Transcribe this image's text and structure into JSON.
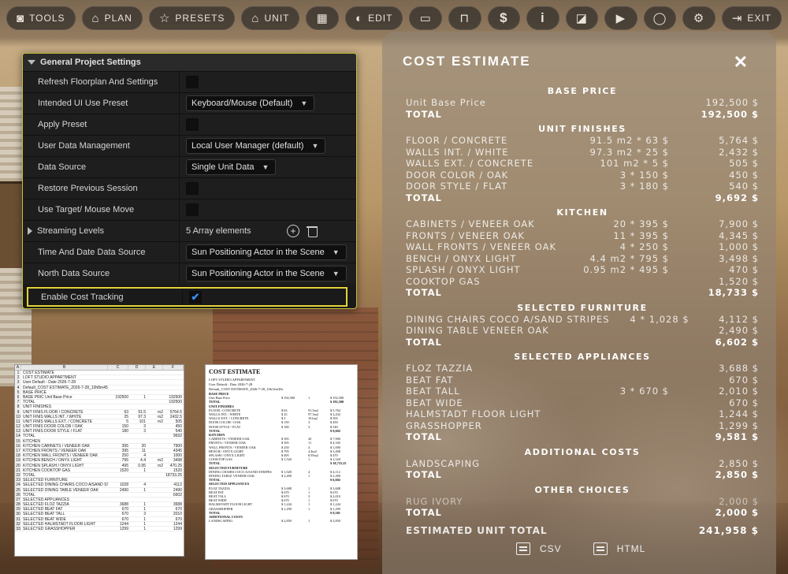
{
  "toolbar": {
    "buttons": [
      {
        "label": "TOOLS",
        "icon": "camera-icon"
      },
      {
        "label": "PLAN",
        "icon": "plan-icon"
      },
      {
        "label": "PRESETS",
        "icon": "star-icon"
      },
      {
        "label": "UNIT",
        "icon": "unit-icon"
      },
      {
        "label": "",
        "icon": "floorplan-icon"
      },
      {
        "label": "EDIT",
        "icon": "palette-icon"
      },
      {
        "label": "",
        "icon": "sofa-icon"
      },
      {
        "label": "",
        "icon": "measure-icon"
      },
      {
        "label": "$",
        "icon": "dollar-icon"
      },
      {
        "label": "i",
        "icon": "info-icon"
      },
      {
        "label": "",
        "icon": "chart-icon"
      },
      {
        "label": "",
        "icon": "play-icon"
      },
      {
        "label": "",
        "icon": "user-icon"
      },
      {
        "label": "",
        "icon": "gear-icon"
      },
      {
        "label": "EXIT",
        "icon": "exit-icon"
      }
    ]
  },
  "settings": {
    "header": "General Project Settings",
    "rows": [
      {
        "label": "Refresh Floorplan And Settings",
        "type": "checkbox",
        "checked": false
      },
      {
        "label": "Intended UI Use Preset",
        "type": "combo",
        "value": "Keyboard/Mouse (Default)"
      },
      {
        "label": "Apply Preset",
        "type": "checkbox",
        "checked": false
      },
      {
        "label": "User Data Management",
        "type": "combo",
        "value": "Local User Manager (default)"
      },
      {
        "label": "Data Source",
        "type": "combo",
        "value": "Single Unit Data"
      },
      {
        "label": "Restore Previous Session",
        "type": "checkbox",
        "checked": false
      },
      {
        "label": "Use Target/ Mouse Move",
        "type": "checkbox",
        "checked": false
      },
      {
        "label": "Streaming Levels",
        "type": "array",
        "value": "5 Array elements"
      },
      {
        "label": "Time And Date Data Source",
        "type": "combo",
        "value": "Sun Positioning Actor in the Scene"
      },
      {
        "label": "North Data Source",
        "type": "combo",
        "value": "Sun Positioning Actor in the Scene"
      },
      {
        "label": "Enable Cost Tracking",
        "type": "checkbox",
        "checked": true
      }
    ]
  },
  "cost": {
    "title": "COST ESTIMATE",
    "close": "✕",
    "sections": [
      {
        "heading": "BASE PRICE",
        "lines": [
          {
            "name": "Unit Base Price",
            "qty": "",
            "amount": "192,500 $"
          }
        ],
        "total": "192,500 $"
      },
      {
        "heading": "UNIT FINISHES",
        "lines": [
          {
            "name": "FLOOR / CONCRETE",
            "qty": "91.5 m2 * 63 $",
            "amount": "5,764 $"
          },
          {
            "name": "WALLS INT. / WHITE",
            "qty": "97.3 m2 * 25 $",
            "amount": "2,432 $"
          },
          {
            "name": "WALLS EXT. / CONCRETE",
            "qty": "101 m2 * 5 $",
            "amount": "505 $"
          },
          {
            "name": "DOOR COLOR / OAK",
            "qty": "3 * 150 $",
            "amount": "450 $"
          },
          {
            "name": "DOOR STYLE / FLAT",
            "qty": "3 * 180 $",
            "amount": "540 $"
          }
        ],
        "total": "9,692 $"
      },
      {
        "heading": "KITCHEN",
        "lines": [
          {
            "name": "CABINETS / VENEER OAK",
            "qty": "20 * 395 $",
            "amount": "7,900 $"
          },
          {
            "name": "FRONTS / VENEER OAK",
            "qty": "11 * 395 $",
            "amount": "4,345 $"
          },
          {
            "name": "WALL FRONTS / VENEER OAK",
            "qty": "4 * 250 $",
            "amount": "1,000 $"
          },
          {
            "name": "BENCH / ONYX LIGHT",
            "qty": "4.4 m2 * 795 $",
            "amount": "3,498 $"
          },
          {
            "name": "SPLASH / ONYX LIGHT",
            "qty": "0.95 m2 * 495 $",
            "amount": "470 $"
          },
          {
            "name": "COOKTOP GAS",
            "qty": "",
            "amount": "1,520 $"
          }
        ],
        "total": "18,733 $"
      },
      {
        "heading": "SELECTED FURNITURE",
        "lines": [
          {
            "name": "DINING CHAIRS COCO A/SAND STRIPES",
            "qty": "4 * 1,028 $",
            "amount": "4,112 $"
          },
          {
            "name": "DINING TABLE VENEER OAK",
            "qty": "",
            "amount": "2,490 $"
          }
        ],
        "total": "6,602 $"
      },
      {
        "heading": "SELECTED APPLIANCES",
        "lines": [
          {
            "name": "FLOZ TAZZIA",
            "qty": "",
            "amount": "3,688 $"
          },
          {
            "name": "BEAT FAT",
            "qty": "",
            "amount": "670 $"
          },
          {
            "name": "BEAT TALL",
            "qty": "3 * 670 $",
            "amount": "2,010 $"
          },
          {
            "name": "BEAT WIDE",
            "qty": "",
            "amount": "670 $"
          },
          {
            "name": "HALMSTADT FLOOR LIGHT",
            "qty": "",
            "amount": "1,244 $"
          },
          {
            "name": "GRASSHOPPER",
            "qty": "",
            "amount": "1,299 $"
          }
        ],
        "total": "9,581 $"
      },
      {
        "heading": "ADDITIONAL COSTS",
        "lines": [
          {
            "name": "LANDSCAPING",
            "qty": "",
            "amount": "2,850 $"
          }
        ],
        "total": "2,850 $"
      },
      {
        "heading": "OTHER CHOICES",
        "lines": [
          {
            "name": "RUG IVORY",
            "qty": "",
            "amount": "2,000 $",
            "dim": true
          }
        ],
        "total": "2,000 $"
      }
    ],
    "total_label": "TOTAL",
    "grand_label": "ESTIMATED UNIT TOTAL",
    "grand_total": "241,958 $",
    "export_csv": "CSV",
    "export_html": "HTML"
  },
  "sheet": {
    "columns": [
      "A",
      "B",
      "C",
      "D",
      "E",
      "F"
    ],
    "rows": [
      [
        "COST ESTIMATE",
        "",
        "",
        "",
        ""
      ],
      [
        "LOFT STUDIO APPARTMENT",
        "",
        "",
        "",
        ""
      ],
      [
        "User Default - Date 2026-7-28",
        "",
        "",
        "",
        ""
      ],
      [
        "Default_COST ESTIMATE_2026-7-28_10h8m45s",
        "",
        "",
        "",
        ""
      ],
      [
        "BASE PRICE",
        "",
        "",
        "",
        ""
      ],
      [
        "BASE PRIC  Unit Base Price",
        "192500",
        "1",
        "",
        "192500"
      ],
      [
        "TOTAL",
        "",
        "",
        "",
        "192500"
      ],
      [
        "UNIT FINISHES",
        "",
        "",
        "",
        ""
      ],
      [
        "UNIT FINIS FLOOR / CONCRETE",
        "63",
        "91.5",
        "m2",
        "5764.5"
      ],
      [
        "UNIT FINIS WALLS INT. / WHITE",
        "25",
        "97.3",
        "m2",
        "2432.5"
      ],
      [
        "UNIT FINIS WALLS EXT. / CONCRETE",
        "5",
        "101",
        "m2",
        "505"
      ],
      [
        "UNIT FINIS DOOR COLOR / OAK",
        "150",
        "3",
        "",
        "450"
      ],
      [
        "UNIT FINIS DOOR STYLE / FLAT",
        "180",
        "3",
        "",
        "540"
      ],
      [
        "TOTAL",
        "",
        "",
        "",
        "9692"
      ],
      [
        "KITCHEN",
        "",
        "",
        "",
        ""
      ],
      [
        "KITCHEN  CABINETS / VENEER OAK",
        "395",
        "20",
        "",
        "7900"
      ],
      [
        "KITCHEN  FRONTS / VENEER OAK",
        "395",
        "11",
        "",
        "4345"
      ],
      [
        "KITCHEN  WALL FRONTS / VENEER OAK",
        "250",
        "4",
        "",
        "1000"
      ],
      [
        "KITCHEN  BENCH / ONYX LIGHT",
        "795",
        "4.4",
        "m2",
        "3498"
      ],
      [
        "KITCHEN  SPLASH / ONYX LIGHT",
        "495",
        "0.95",
        "m2",
        "470.25"
      ],
      [
        "KITCHEN  COOKTOP GAS",
        "1520",
        "1",
        "",
        "1520"
      ],
      [
        "TOTAL",
        "",
        "",
        "",
        "18733.25"
      ],
      [
        "SELECTED FURNITURE",
        "",
        "",
        "",
        ""
      ],
      [
        "SELECTED  DINING CHAIRS COCO A/SAND STRIPES",
        "1028",
        "4",
        "",
        "4112"
      ],
      [
        "SELECTED  DINING TABLE VENEER OAK",
        "2490",
        "1",
        "",
        "2490"
      ],
      [
        "TOTAL",
        "",
        "",
        "",
        "6602"
      ],
      [
        "SELECTED APPLIANCES",
        "",
        "",
        "",
        ""
      ],
      [
        "SELECTED  FLOZ TAZZIA",
        "3688",
        "1",
        "",
        "3688"
      ],
      [
        "SELECTED  BEAT FAT",
        "670",
        "1",
        "",
        "670"
      ],
      [
        "SELECTED  BEAT TALL",
        "670",
        "3",
        "",
        "2010"
      ],
      [
        "SELECTED  BEAT WIDE",
        "670",
        "1",
        "",
        "670"
      ],
      [
        "SELECTED  HALMSTADT FLOOR LIGHT",
        "1244",
        "1",
        "",
        "1244"
      ],
      [
        "SELECTED  GRASSHOPPER",
        "1299",
        "1",
        "",
        "1299"
      ]
    ]
  },
  "doc": {
    "title": "COST ESTIMATE",
    "meta": [
      "LOFT STUDIO APPARTMENT",
      "User Default - Date 2026-7-28",
      "Default_COST ESTIMATE_2026-7-28_10h12m30s"
    ],
    "rows": [
      {
        "c": [
          "BASE PRICE",
          "",
          "",
          ""
        ],
        "b": true
      },
      {
        "c": [
          "Unit Base Price",
          "$ 192,500",
          "1",
          "$ 192,500"
        ]
      },
      {
        "c": [
          "TOTAL",
          "",
          "",
          "$ 192,500"
        ],
        "b": true
      },
      {
        "c": [
          "UNIT FINISHES",
          "",
          "",
          ""
        ],
        "b": true
      },
      {
        "c": [
          "FLOOR / CONCRETE",
          "$ 63",
          "91.5m2",
          "$ 5,764"
        ]
      },
      {
        "c": [
          "WALLS INT. / WHITE",
          "$ 25",
          "97.3m2",
          "$ 2,432"
        ]
      },
      {
        "c": [
          "WALLS EXT. / CONCRETE",
          "$ 5",
          "101m2",
          "$ 505"
        ]
      },
      {
        "c": [
          "DOOR COLOR / OAK",
          "$ 150",
          "3",
          "$ 450"
        ]
      },
      {
        "c": [
          "DOOR STYLE / FLAT",
          "$ 180",
          "3",
          "$ 540"
        ]
      },
      {
        "c": [
          "TOTAL",
          "",
          "",
          "$ 9,692"
        ],
        "b": true
      },
      {
        "c": [
          "KITCHEN",
          "",
          "",
          ""
        ],
        "b": true
      },
      {
        "c": [
          "CABINETS / VENEER OAK",
          "$ 395",
          "20",
          "$ 7,900"
        ]
      },
      {
        "c": [
          "FRONTS / VENEER OAK",
          "$ 395",
          "11",
          "$ 4,345"
        ]
      },
      {
        "c": [
          "WALL FRONTS / VENEER OAK",
          "$ 250",
          "4",
          "$ 1,000"
        ]
      },
      {
        "c": [
          "BENCH / ONYX LIGHT",
          "$ 795",
          "4.4m2",
          "$ 3,498"
        ]
      },
      {
        "c": [
          "SPLASH / ONYX LIGHT",
          "$ 495",
          "0.95m2",
          "$ 470"
        ]
      },
      {
        "c": [
          "COOKTOP GAS",
          "$ 1,520",
          "1",
          "$ 1,520"
        ]
      },
      {
        "c": [
          "TOTAL",
          "",
          "",
          "$ 18,733.25"
        ],
        "b": true
      },
      {
        "c": [
          "SELECTED FURNITURE",
          "",
          "",
          ""
        ],
        "b": true
      },
      {
        "c": [
          "DINING CHAIRS COCO A/SAND STRIPES",
          "$ 1,028",
          "4",
          "$ 4,112"
        ]
      },
      {
        "c": [
          "DINING TABLE VENEER OAK",
          "$ 2,490",
          "1",
          "$ 2,490"
        ]
      },
      {
        "c": [
          "TOTAL",
          "",
          "",
          "$ 6,602"
        ],
        "b": true
      },
      {
        "c": [
          "SELECTED APPLIANCES",
          "",
          "",
          ""
        ],
        "b": true
      },
      {
        "c": [
          "FLOZ TAZZIA",
          "$ 3,688",
          "1",
          "$ 3,688"
        ]
      },
      {
        "c": [
          "BEAT FAT",
          "$ 670",
          "1",
          "$ 670"
        ]
      },
      {
        "c": [
          "BEAT TALL",
          "$ 670",
          "3",
          "$ 2,010"
        ]
      },
      {
        "c": [
          "BEAT WIDE",
          "$ 670",
          "1",
          "$ 670"
        ]
      },
      {
        "c": [
          "HALMSTADT FLOOR LIGHT",
          "$ 1,244",
          "1",
          "$ 1,244"
        ]
      },
      {
        "c": [
          "GRASSHOPPER",
          "$ 1,299",
          "1",
          "$ 1,299"
        ]
      },
      {
        "c": [
          "TOTAL",
          "",
          "",
          "$ 9,581"
        ],
        "b": true
      },
      {
        "c": [
          "ADDITIONAL COSTS",
          "",
          "",
          ""
        ],
        "b": true
      },
      {
        "c": [
          "LANDSCAPING",
          "$ 2,850",
          "1",
          "$ 2,850"
        ]
      }
    ]
  }
}
